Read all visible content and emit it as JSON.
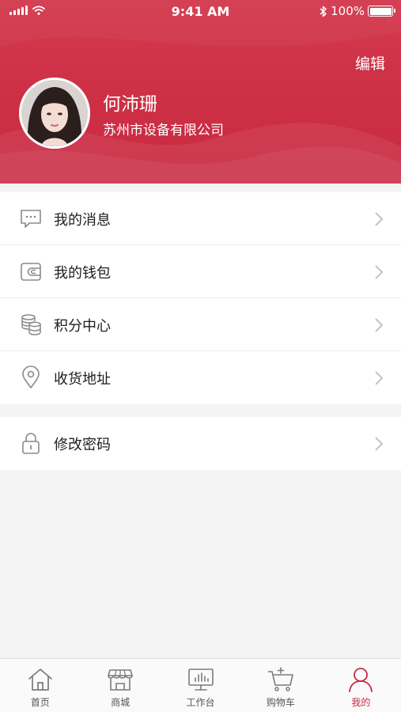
{
  "status_bar": {
    "time": "9:41 AM",
    "battery": "100%"
  },
  "header": {
    "edit_label": "编辑",
    "user_name": "何沛珊",
    "company": "苏州市设备有限公司",
    "background_color": "#cd2f45"
  },
  "menu": {
    "group1": [
      {
        "label": "我的消息",
        "icon": "message-icon"
      },
      {
        "label": "我的钱包",
        "icon": "wallet-icon"
      },
      {
        "label": "积分中心",
        "icon": "coins-icon"
      },
      {
        "label": "收货地址",
        "icon": "location-icon"
      }
    ],
    "group2": [
      {
        "label": "修改密码",
        "icon": "lock-icon"
      }
    ]
  },
  "tabbar": {
    "items": [
      {
        "label": "首页",
        "icon": "home-icon"
      },
      {
        "label": "商城",
        "icon": "store-icon"
      },
      {
        "label": "工作台",
        "icon": "monitor-chart-icon"
      },
      {
        "label": "购物车",
        "icon": "cart-icon"
      },
      {
        "label": "我的",
        "icon": "user-icon",
        "active": true
      }
    ],
    "active_color": "#c82a43"
  }
}
